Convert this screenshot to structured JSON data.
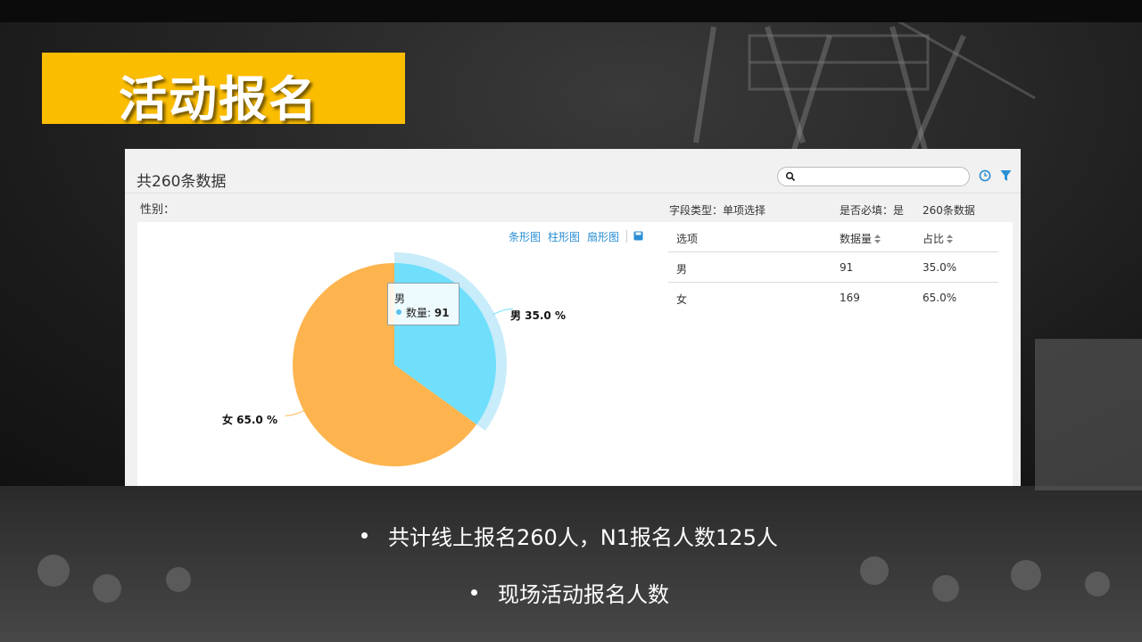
{
  "slide": {
    "title": "活动报名",
    "bullets": [
      "共计线上报名260人，N1报名人数125人",
      "现场活动报名人数"
    ]
  },
  "panel": {
    "count_title": "共260条数据",
    "search": {
      "value": "",
      "placeholder": ""
    },
    "field_label": "性别：",
    "meta": {
      "field_type": "字段类型：单项选择",
      "required": "是否必填：是",
      "total": "260条数据"
    },
    "chart_switch": [
      "条形图",
      "柱形图",
      "扇形图"
    ],
    "table": {
      "headers": [
        "选项",
        "数据量",
        "占比"
      ],
      "rows": [
        [
          "男",
          "91",
          "35.0%"
        ],
        [
          "女",
          "169",
          "65.0%"
        ]
      ]
    },
    "tooltip": {
      "title": "男",
      "label": "数量:",
      "value": "91"
    },
    "colors": {
      "male": "#6fdffc",
      "female": "#fdb44e",
      "male_halo": "#c8ecfa",
      "accent_title": "#fbbd00",
      "link": "#2a8fd4"
    }
  },
  "chart_data": {
    "type": "pie",
    "title": "",
    "slices": [
      {
        "name": "男",
        "value": 91,
        "percent": 35.0,
        "label": "男 35.0 %",
        "highlighted": true
      },
      {
        "name": "女",
        "value": 169,
        "percent": 65.0,
        "label": "女 65.0 %",
        "highlighted": false
      }
    ]
  }
}
